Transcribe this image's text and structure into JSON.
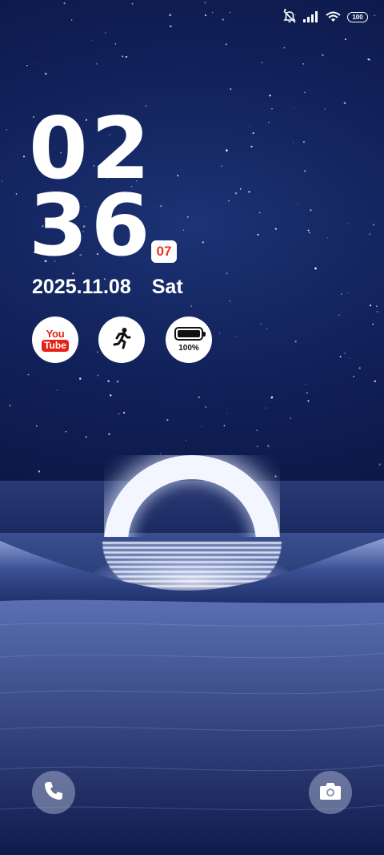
{
  "status_bar": {
    "icons": [
      "mute-vibrate-icon",
      "signal-icon",
      "wifi-icon"
    ],
    "battery_level": "100"
  },
  "clock": {
    "hours": "02",
    "minutes": "36",
    "seconds": "07"
  },
  "date": {
    "date": "2025.11.08",
    "weekday": "Sat"
  },
  "widgets": {
    "youtube": {
      "you": "You",
      "tube": "Tube"
    },
    "workout": {
      "icon": "running-icon"
    },
    "battery": {
      "label": "100%",
      "level": 1.0
    }
  },
  "shortcuts": {
    "left_icon": "phone-icon",
    "right_icon": "camera-icon"
  },
  "colors": {
    "seconds_accent": "#e8342b",
    "youtube_red": "#e62117",
    "sky": "#11215a"
  }
}
